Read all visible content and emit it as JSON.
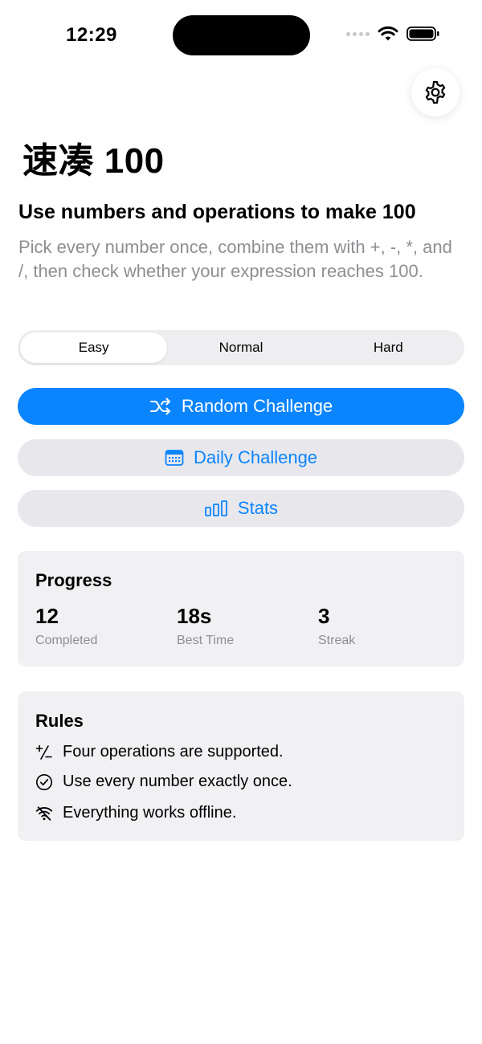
{
  "status_bar": {
    "time": "12:29"
  },
  "app": {
    "title": "速凑 100",
    "headline": "Use numbers and operations to make 100",
    "description": "Pick every number once, combine them with +, -, *, and /, then check whether your expression reaches 100."
  },
  "difficulty": {
    "options": [
      "Easy",
      "Normal",
      "Hard"
    ],
    "selected": "Easy"
  },
  "actions": {
    "random": {
      "label": "Random Challenge",
      "icon": "shuffle-icon"
    },
    "daily": {
      "label": "Daily Challenge",
      "icon": "calendar-icon"
    },
    "stats": {
      "label": "Stats",
      "icon": "bar-chart-icon"
    }
  },
  "progress": {
    "title": "Progress",
    "stats": [
      {
        "value": "12",
        "label": "Completed"
      },
      {
        "value": "18s",
        "label": "Best Time"
      },
      {
        "value": "3",
        "label": "Streak"
      }
    ]
  },
  "rules": {
    "title": "Rules",
    "items": [
      {
        "text": "Four operations are supported.",
        "icon": "plus-minus-icon"
      },
      {
        "text": "Use every number exactly once.",
        "icon": "checkmark-circle-icon"
      },
      {
        "text": "Everything works offline.",
        "icon": "wifi-off-icon"
      }
    ]
  },
  "colors": {
    "accent": "#0a84ff",
    "card_bg": "#f1f1f4",
    "secondary_text": "#8e8e93"
  }
}
